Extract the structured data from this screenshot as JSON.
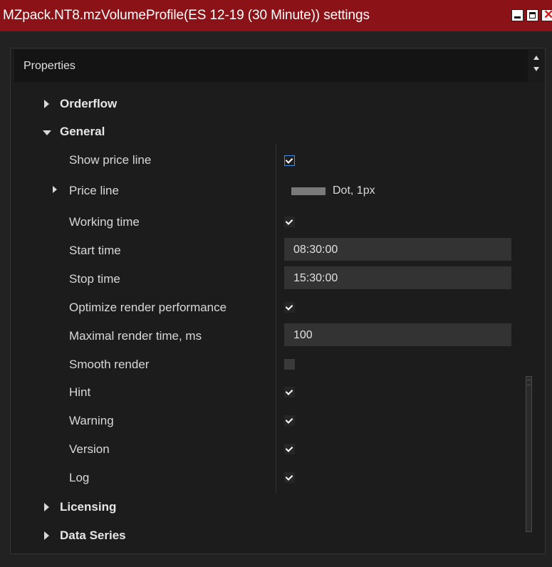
{
  "window": {
    "title": "MZpack.NT8.mzVolumeProfile(ES 12-19 (30 Minute)) settings",
    "controls": [
      "minimize-icon",
      "maximize-icon",
      "close-icon"
    ]
  },
  "panel": {
    "header": "Properties"
  },
  "categories": {
    "orderflow": "Orderflow",
    "general": "General",
    "licensing": "Licensing",
    "data_series": "Data Series"
  },
  "general": {
    "show_price_line": {
      "label": "Show price line",
      "checked": true
    },
    "price_line": {
      "label": "Price line",
      "value": "Dot, 1px",
      "swatch_color": "#7a7a7a"
    },
    "working_time": {
      "label": "Working time",
      "checked": true
    },
    "start_time": {
      "label": "Start time",
      "value": "08:30:00"
    },
    "stop_time": {
      "label": "Stop time",
      "value": "15:30:00"
    },
    "optimize_render": {
      "label": "Optimize render performance",
      "checked": true
    },
    "max_render_time": {
      "label": "Maximal render time, ms",
      "value": "100"
    },
    "smooth_render": {
      "label": "Smooth render",
      "checked": false
    },
    "hint": {
      "label": "Hint",
      "checked": true
    },
    "warning": {
      "label": "Warning",
      "checked": true
    },
    "version": {
      "label": "Version",
      "checked": true
    },
    "log": {
      "label": "Log",
      "checked": true
    }
  },
  "colors": {
    "titlebar": "#8b1217",
    "background": "#222222",
    "field": "#333333",
    "focus": "#3d8ee8"
  }
}
